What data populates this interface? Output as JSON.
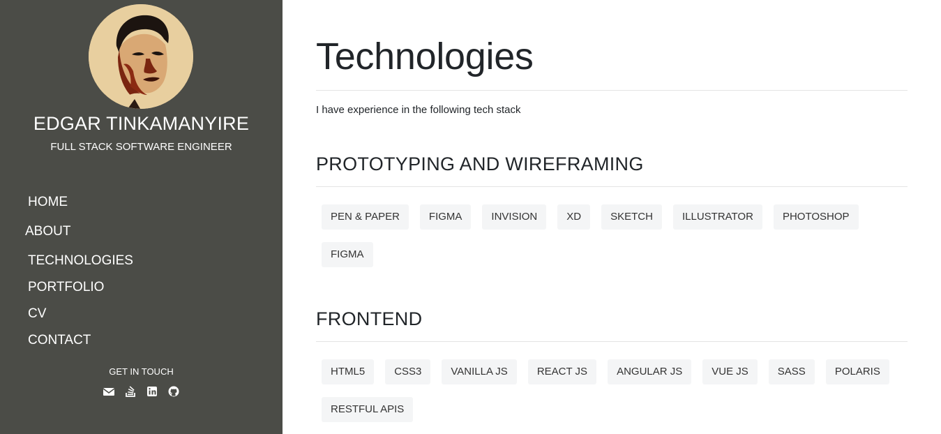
{
  "sidebar": {
    "name": "EDGAR TINKAMANYIRE",
    "role": "FULL STACK SOFTWARE ENGINEER",
    "nav": [
      "HOME",
      "ABOUT",
      "TECHNOLOGIES",
      "PORTFOLIO",
      "CV",
      "CONTACT"
    ],
    "get_in_touch": "GET IN TOUCH",
    "socials": [
      "envelope-icon",
      "stack-overflow-icon",
      "linkedin-icon",
      "github-icon"
    ]
  },
  "main": {
    "title": "Technologies",
    "intro": "I have experience in the following tech stack",
    "sections": [
      {
        "title": "PROTOTYPING AND WIREFRAMING",
        "tags": [
          "PEN & PAPER",
          "FIGMA",
          "INVISION",
          "XD",
          "SKETCH",
          "ILLUSTRATOR",
          "PHOTOSHOP",
          "FIGMA"
        ]
      },
      {
        "title": "FRONTEND",
        "tags": [
          "HTML5",
          "CSS3",
          "VANILLA JS",
          "REACT JS",
          "ANGULAR JS",
          "VUE JS",
          "SASS",
          "POLARIS",
          "RESTFUL APIS"
        ]
      }
    ]
  },
  "colors": {
    "sidebar_bg": "#4b4c47",
    "tag_bg": "#f4f5f6",
    "avatar_bg": "#e8cf9f"
  }
}
